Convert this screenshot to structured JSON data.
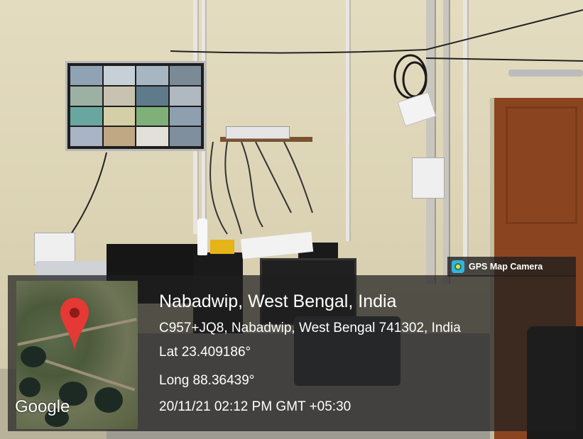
{
  "badge": {
    "label": "GPS Map Camera",
    "icon": "gps-map-camera-app-icon"
  },
  "map": {
    "attribution": "Google",
    "marker_icon": "location-pin-icon",
    "pin_color": "#e53935"
  },
  "location": {
    "title": "Nabadwip, West Bengal, India",
    "address": "C957+JQ8, Nabadwip, West Bengal 741302, India",
    "latitude": "Lat 23.409186°",
    "longitude": "Long 88.36439°",
    "datetime": "20/11/21 02:12 PM GMT +05:30"
  }
}
